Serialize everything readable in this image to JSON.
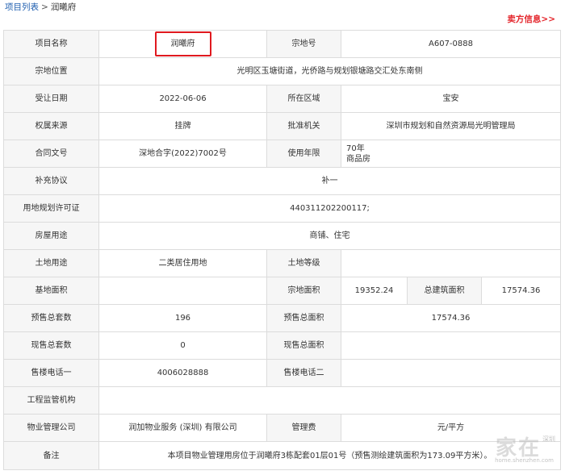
{
  "breadcrumb": {
    "root": "项目列表",
    "separator": ">",
    "current": "润曦府"
  },
  "seller_link": "卖方信息>>",
  "project_name": {
    "label": "项目名称",
    "value": "润曦府"
  },
  "parcel_no": {
    "label": "宗地号",
    "value": "A607-0888"
  },
  "location": {
    "label": "宗地位置",
    "value": "光明区玉塘街道，光侨路与规划银塘路交汇处东南侧"
  },
  "transfer_date": {
    "label": "受让日期",
    "value": "2022-06-06"
  },
  "district": {
    "label": "所在区域",
    "value": "宝安"
  },
  "ownership_source": {
    "label": "权属来源",
    "value": "挂牌"
  },
  "approval_authority": {
    "label": "批准机关",
    "value": "深圳市规划和自然资源局光明管理局"
  },
  "contract_no": {
    "label": "合同文号",
    "value": "深地合字(2022)7002号"
  },
  "use_term": {
    "label": "使用年限",
    "years": "70年",
    "type": "商品房"
  },
  "supplementary": {
    "label": "补充协议",
    "value": "补一"
  },
  "planning_permit": {
    "label": "用地规划许可证",
    "value": "440311202200117;"
  },
  "house_use": {
    "label": "房屋用途",
    "value": "商铺、住宅"
  },
  "land_use": {
    "label": "土地用途",
    "value": "二类居住用地"
  },
  "land_grade": {
    "label": "土地等级",
    "value": ""
  },
  "base_area": {
    "label": "基地面积",
    "value": ""
  },
  "parcel_area": {
    "label": "宗地面积",
    "value": "19352.24"
  },
  "total_floor_area": {
    "label": "总建筑面积",
    "value": "17574.36"
  },
  "presale_units": {
    "label": "预售总套数",
    "value": "196"
  },
  "presale_area": {
    "label": "预售总面积",
    "value": "17574.36"
  },
  "spot_units": {
    "label": "现售总套数",
    "value": "0"
  },
  "spot_area": {
    "label": "现售总面积",
    "value": ""
  },
  "sales_phone1": {
    "label": "售楼电话一",
    "value": "4006028888"
  },
  "sales_phone2": {
    "label": "售楼电话二",
    "value": ""
  },
  "supervisor": {
    "label": "工程监管机构",
    "value": ""
  },
  "property_mgmt": {
    "label": "物业管理公司",
    "value": "润加物业服务 (深圳) 有限公司"
  },
  "mgmt_fee": {
    "label": "管理费",
    "value": "元/平方"
  },
  "remark": {
    "label": "备注",
    "value": "本项目物业管理用房位于润曦府3栋配套01层01号（预售测绘建筑面积为173.09平方米）。"
  },
  "watermark": {
    "main": "家在",
    "sub": "深圳",
    "url": "home.shenzhen.com"
  },
  "colors": {
    "highlight_border": "#e0191f",
    "seller_link": "#e4262c",
    "breadcrumb_link": "#1f5fb0",
    "label_bg": "#f6f6f6"
  }
}
